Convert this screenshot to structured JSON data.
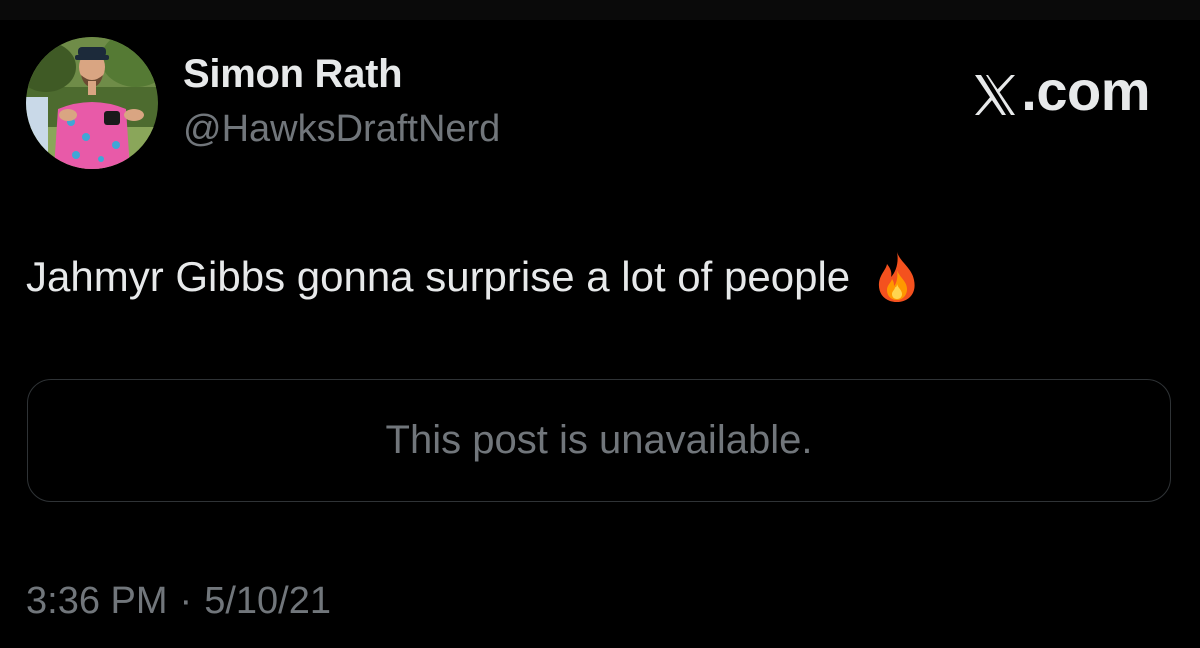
{
  "author": {
    "name": "Simon Rath",
    "handle": "@HawksDraftNerd"
  },
  "brand": {
    "label": ".com",
    "icon": "x-logo-icon"
  },
  "post": {
    "text": "Jahmyr Gibbs gonna surprise a lot of people",
    "emoji_icon": "fire-emoji-icon"
  },
  "quoted_post": {
    "message": "This post is unavailable."
  },
  "meta": {
    "time": "3:36 PM",
    "separator": "·",
    "date": "5/10/21"
  },
  "colors": {
    "background": "#000000",
    "text_primary": "#e7e9ea",
    "text_secondary": "#71767b",
    "border": "#2f3336"
  }
}
